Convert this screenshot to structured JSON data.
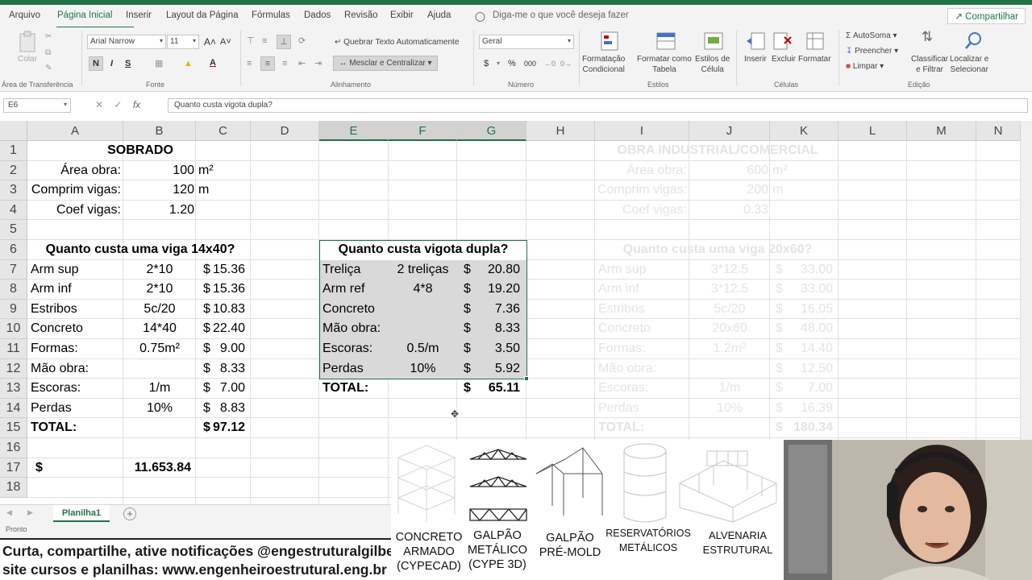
{
  "tabs": [
    "Arquivo",
    "Página Inicial",
    "Inserir",
    "Layout da Página",
    "Fórmulas",
    "Dados",
    "Revisão",
    "Exibir",
    "Ajuda"
  ],
  "tell_me": "Diga-me o que você deseja fazer",
  "share_label": "Compartilhar",
  "ribbon": {
    "clipboard": {
      "paste": "Colar",
      "group": "Área de Transferência"
    },
    "font": {
      "name": "Arial Narrow",
      "size": "11",
      "bold": "N",
      "italic": "I",
      "underline": "S",
      "group": "Fonte"
    },
    "alignment": {
      "wrap": "Quebrar Texto Automaticamente",
      "merge": "Mesclar e Centralizar",
      "group": "Alinhamento"
    },
    "number": {
      "format": "Geral",
      "group": "Número"
    },
    "styles": {
      "conditional": "Formatação\nCondicional",
      "table": "Formatar como\nTabela",
      "cell": "Estilos de\nCélula",
      "group": "Estilos"
    },
    "cells": {
      "insert": "Inserir",
      "delete": "Excluir",
      "format": "Formatar",
      "group": "Células"
    },
    "editing": {
      "autosum": "AutoSoma",
      "fill": "Preencher",
      "clear": "Limpar",
      "sort": "Classificar\ne Filtrar",
      "find": "Localizar e\nSelecionar",
      "group": "Edição"
    }
  },
  "formula_bar": {
    "name_box": "E6",
    "formula": "Quanto custa vigota dupla?"
  },
  "columns": [
    "A",
    "B",
    "C",
    "D",
    "E",
    "F",
    "G",
    "H",
    "I",
    "J",
    "K",
    "L",
    "M",
    "N"
  ],
  "rows": [
    "1",
    "2",
    "3",
    "4",
    "5",
    "6",
    "7",
    "8",
    "9",
    "10",
    "11",
    "12",
    "13",
    "14",
    "15",
    "16",
    "17",
    "18"
  ],
  "sheet": {
    "sobrado": {
      "title": "SOBRADO",
      "area_label": "Área obra:",
      "area_value": "100",
      "area_unit": "m²",
      "vigas_label": "Comprim vigas:",
      "vigas_value": "120",
      "vigas_unit": "m",
      "coef_label": "Coef vigas:",
      "coef_value": "1.20",
      "question": "Quanto custa uma viga 14x40?",
      "items": [
        {
          "label": "Arm sup",
          "qty": "2*10",
          "cur": "$",
          "price": "15.36"
        },
        {
          "label": "Arm inf",
          "qty": "2*10",
          "cur": "$",
          "price": "15.36"
        },
        {
          "label": "Estribos",
          "qty": "5c/20",
          "cur": "$",
          "price": "10.83"
        },
        {
          "label": "Concreto",
          "qty": "14*40",
          "cur": "$",
          "price": "22.40"
        },
        {
          "label": "Formas:",
          "qty": "0.75m²",
          "cur": "$",
          "price": "9.00"
        },
        {
          "label": "Mão obra:",
          "qty": "",
          "cur": "$",
          "price": "8.33"
        },
        {
          "label": "Escoras:",
          "qty": "1/m",
          "cur": "$",
          "price": "7.00"
        },
        {
          "label": "Perdas",
          "qty": "10%",
          "cur": "$",
          "price": "8.83"
        }
      ],
      "total_label": "TOTAL:",
      "total_cur": "$",
      "total_value": "97.12",
      "grand_cur": "$",
      "grand_value": "11.653.84"
    },
    "vigota": {
      "question": "Quanto custa vigota dupla?",
      "items": [
        {
          "label": "Treliça",
          "qty": "2 treliças",
          "cur": "$",
          "price": "20.80"
        },
        {
          "label": "Arm ref",
          "qty": "4*8",
          "cur": "$",
          "price": "19.20"
        },
        {
          "label": "Concreto",
          "qty": "",
          "cur": "$",
          "price": "7.36"
        },
        {
          "label": "Mão obra:",
          "qty": "",
          "cur": "$",
          "price": "8.33"
        },
        {
          "label": "Escoras:",
          "qty": "0.5/m",
          "cur": "$",
          "price": "3.50"
        },
        {
          "label": "Perdas",
          "qty": "10%",
          "cur": "$",
          "price": "5.92"
        }
      ],
      "total_label": "TOTAL:",
      "total_cur": "$",
      "total_value": "65.11"
    },
    "industrial": {
      "title": "OBRA INDUSTRIAL/COMERCIAL",
      "area_label": "Área obra:",
      "area_value": "600",
      "area_unit": "m²",
      "vigas_label": "Comprim vigas:",
      "vigas_value": "200",
      "vigas_unit": "m",
      "coef_label": "Coef vigas:",
      "coef_value": "0.33",
      "question": "Quanto custa uma viga 20x60?",
      "items": [
        {
          "label": "Arm sup",
          "qty": "3*12.5",
          "cur": "$",
          "price": "33.00"
        },
        {
          "label": "Arm inf",
          "qty": "3*12.5",
          "cur": "$",
          "price": "33.00"
        },
        {
          "label": "Estribos",
          "qty": "5c/20",
          "cur": "$",
          "price": "16.05"
        },
        {
          "label": "Concreto",
          "qty": "20x60",
          "cur": "$",
          "price": "48.00"
        },
        {
          "label": "Formas:",
          "qty": "1.2m²",
          "cur": "$",
          "price": "14.40"
        },
        {
          "label": "Mão obra:",
          "qty": "",
          "cur": "$",
          "price": "12.50"
        },
        {
          "label": "Escoras:",
          "qty": "1/m",
          "cur": "$",
          "price": "7.00"
        },
        {
          "label": "Perdas",
          "qty": "10%",
          "cur": "$",
          "price": "16.39"
        }
      ],
      "total_label": "TOTAL:",
      "total_cur": "$",
      "total_value": "180.34"
    }
  },
  "sheet_tab": "Planilha1",
  "status": "Pronto",
  "caption": {
    "line1": "Curta, compartilhe, ative notificações @engestruturalgilberto",
    "line2": "site cursos e planilhas: www.engenheiroestrutural.eng.br"
  },
  "overlay_labels": [
    "CONCRETO\nARMADO\n(CYPECAD)",
    "GALPÃO\nMETÁLICO\n(CYPE 3D)",
    "GALPÃO\nPRÉ-MOLD",
    "RESERVATÓRIOS\nMETÁLICOS",
    "ALVENARIA\nESTRUTURAL"
  ],
  "colors": {
    "accent": "#217346",
    "selection": "#d9d9d9",
    "faded_text": "#e4e4e4"
  }
}
